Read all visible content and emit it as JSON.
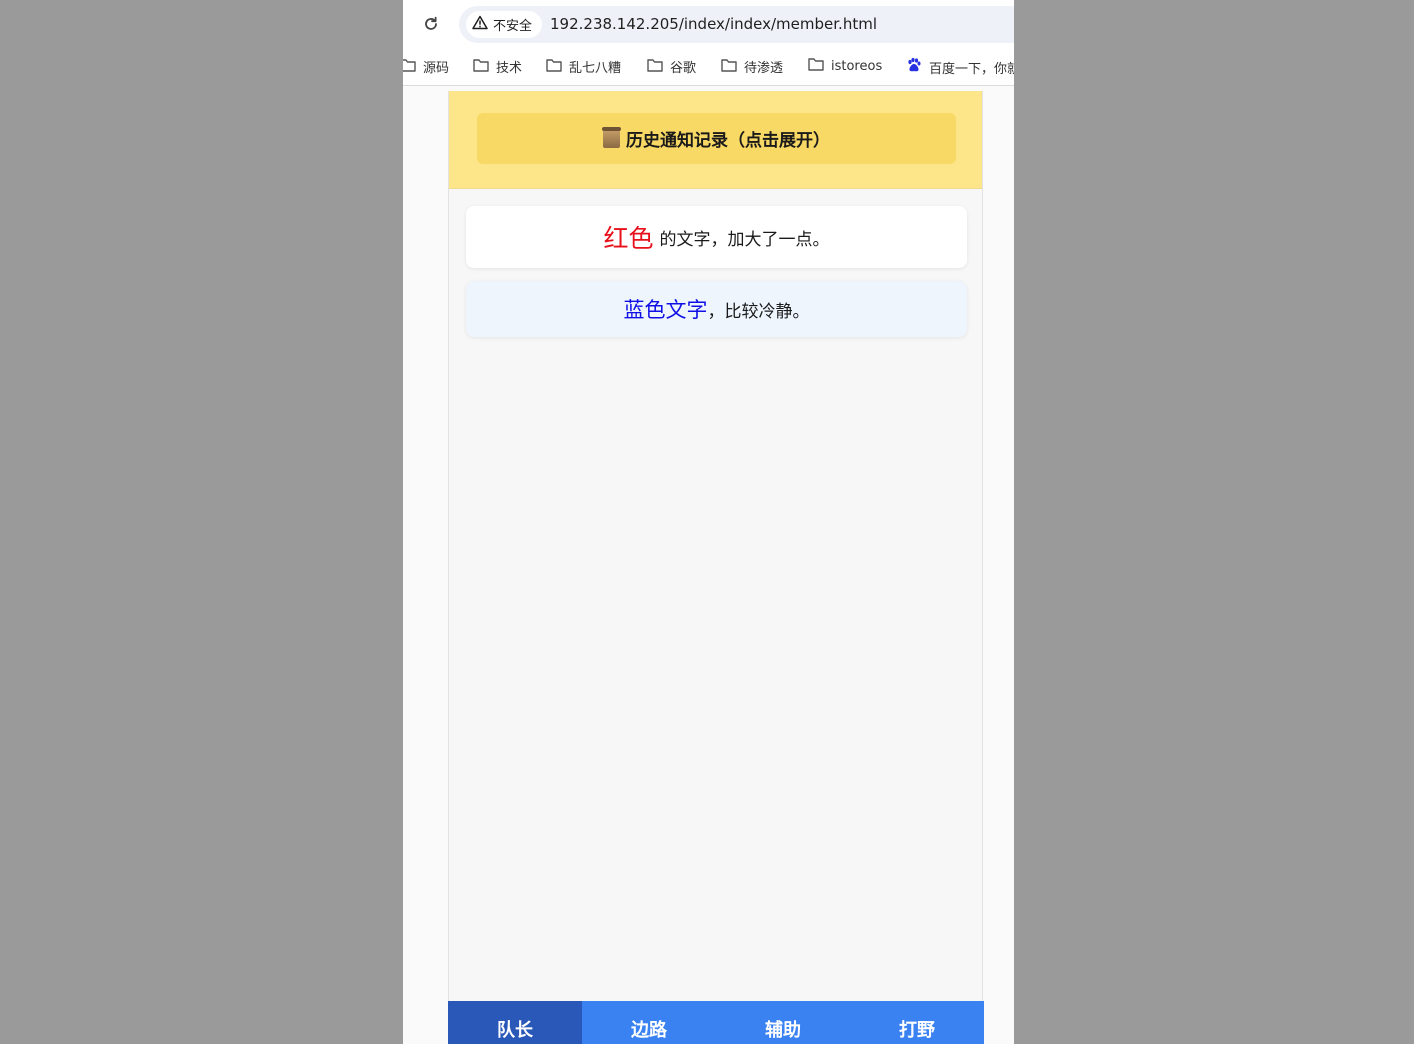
{
  "browser": {
    "security_label": "不安全",
    "url": "192.238.142.205/index/index/member.html"
  },
  "bookmarks": [
    {
      "label": "源码",
      "icon": "folder-icon"
    },
    {
      "label": "技术",
      "icon": "folder-icon"
    },
    {
      "label": "乱七八糟",
      "icon": "folder-icon"
    },
    {
      "label": "谷歌",
      "icon": "folder-icon"
    },
    {
      "label": "待渗透",
      "icon": "folder-icon"
    },
    {
      "label": "istoreos",
      "icon": "folder-icon"
    },
    {
      "label": "百度一下，你就",
      "icon": "baidu-paw-icon"
    }
  ],
  "notice": {
    "button_label": "历史通知记录（点击展开）",
    "icon": "scroll-icon"
  },
  "messages": {
    "red": {
      "highlight": "红色",
      "rest": "的文字，加大了一点。",
      "highlight_color": "#e8111b"
    },
    "blue": {
      "highlight": "蓝色文字",
      "rest": "，比较冷静。",
      "highlight_color": "#1010e6"
    }
  },
  "tabs": [
    {
      "label": "队长",
      "active": true
    },
    {
      "label": "边路",
      "active": false
    },
    {
      "label": "辅助",
      "active": false
    },
    {
      "label": "打野",
      "active": false
    }
  ],
  "colors": {
    "tab_active": "#2958b8",
    "tab_bar": "#3a82f2",
    "notice_header": "#fde68a",
    "notice_button": "#f9d965"
  }
}
